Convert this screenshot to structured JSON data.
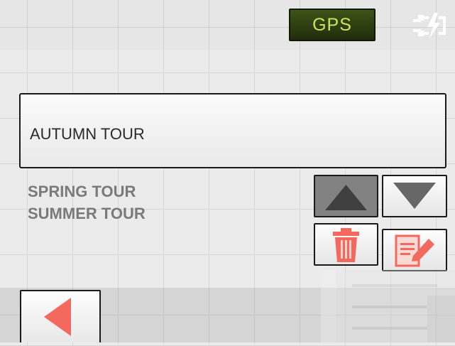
{
  "status": {
    "gps_label": "GPS"
  },
  "icons": {
    "power": "plug-charging-icon",
    "up": "arrow-up-icon",
    "down": "arrow-down-icon",
    "delete": "trash-icon",
    "edit": "edit-note-icon",
    "back": "back-arrow-icon"
  },
  "tour": {
    "selected": "AUTUMN TOUR",
    "items": [
      "SPRING TOUR",
      "SUMMER TOUR"
    ]
  },
  "colors": {
    "accent_red": "#f3695e",
    "gps_text": "#c8e65a",
    "gps_bg": "#2d3d12"
  }
}
